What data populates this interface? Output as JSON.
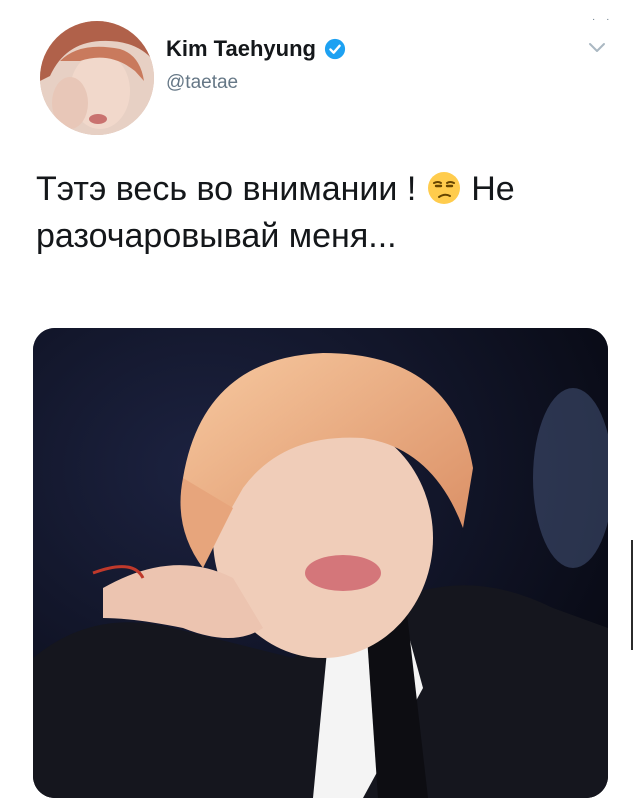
{
  "tweet": {
    "display_name": "Kim Taehyung",
    "handle": "@taetae",
    "verified_icon": "verified-badge-icon",
    "text_before_emoji": "Тэтэ весь во внимании ! ",
    "emoji": "unamused-face-emoji",
    "text_after_emoji": " Не разочаровывай меня...",
    "menu_icon": "chevron-down-icon"
  },
  "colors": {
    "verified": "#1da1f2",
    "handle": "#657786",
    "text": "#14171a",
    "media_background": "#0b0d1a"
  }
}
